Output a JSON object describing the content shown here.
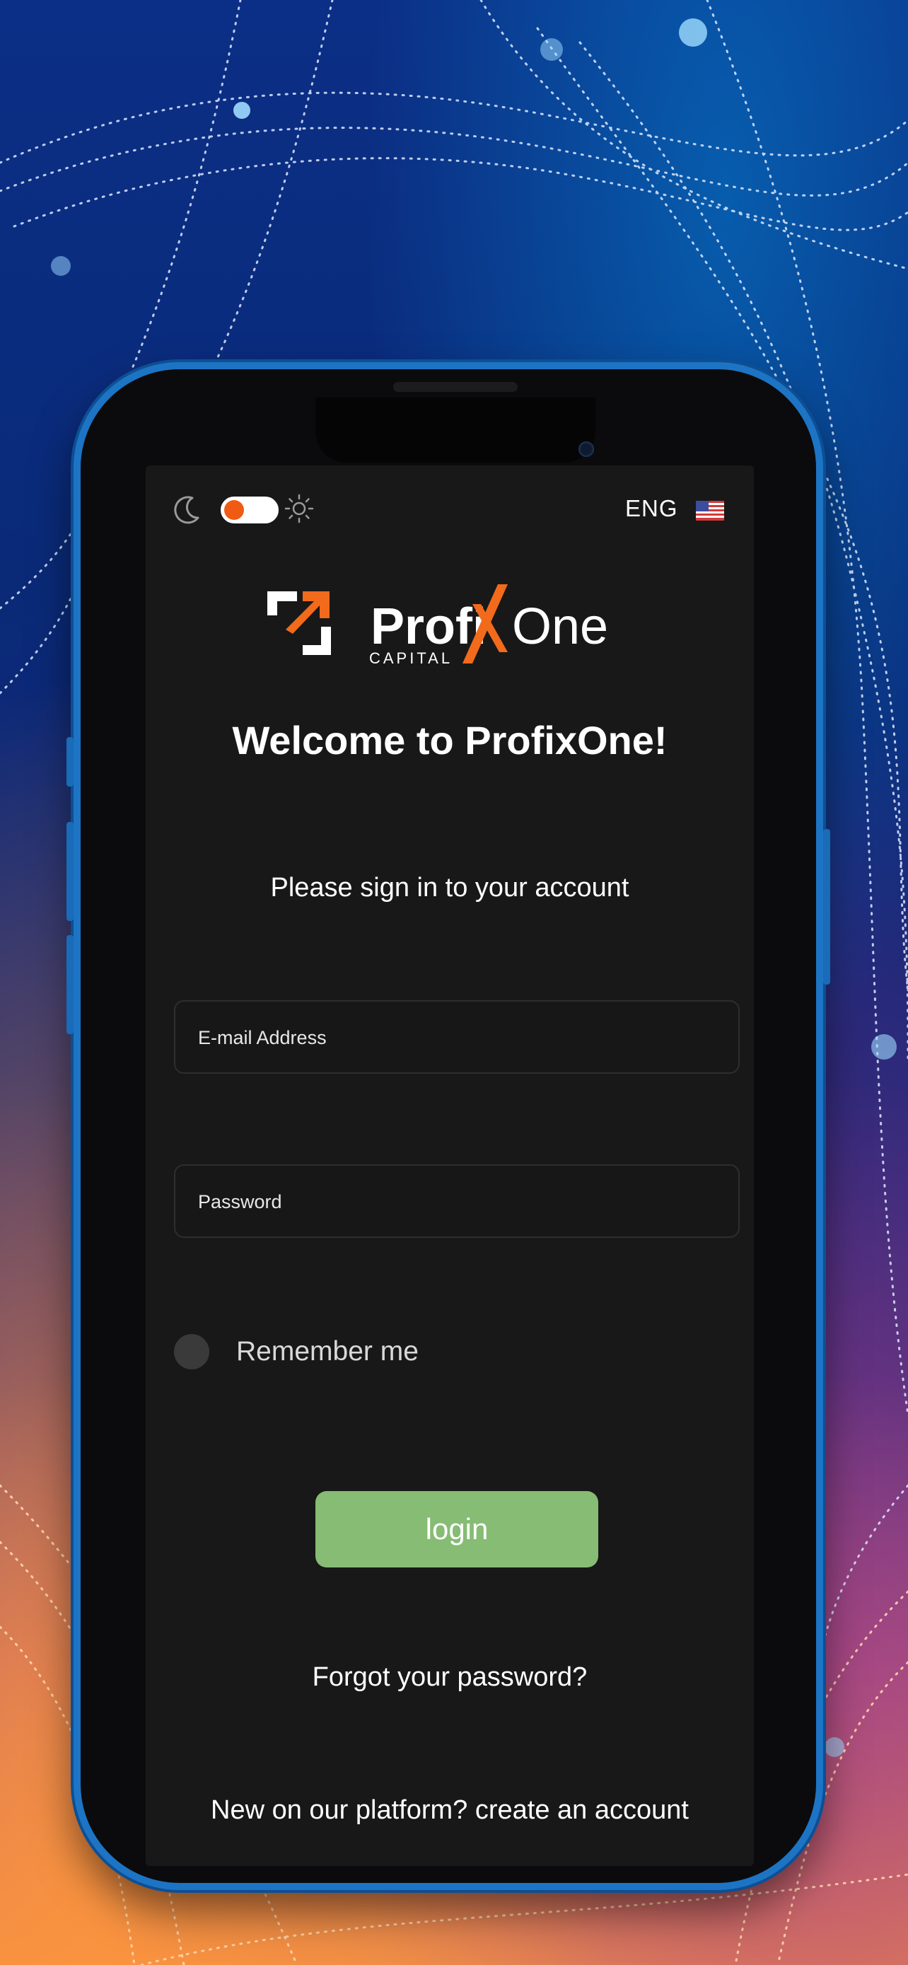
{
  "theme": {
    "dark_icon": "moon-icon",
    "light_icon": "sun-icon",
    "toggle_accent": "#f05a12"
  },
  "language": {
    "label": "ENG",
    "flag_icon": "us-flag-icon"
  },
  "logo": {
    "name_part1": "Profi",
    "name_x": "X",
    "name_part2": "One",
    "tagline": "CAPITAL",
    "accent_color": "#f26a1b"
  },
  "welcome_title": "Welcome to ProfixOne!",
  "subtitle": "Please sign in to your account",
  "form": {
    "email_placeholder": "E-mail Address",
    "email_value": "",
    "password_placeholder": "Password",
    "password_value": "",
    "remember_label": "Remember me",
    "login_label": "login",
    "login_color": "#86bc73"
  },
  "forgot_label": "Forgot your password?",
  "register": {
    "prompt": "New on our platform?",
    "link": "create an account"
  },
  "colors": {
    "screen_bg": "#181818",
    "phone_frame": "#1d74c4"
  }
}
